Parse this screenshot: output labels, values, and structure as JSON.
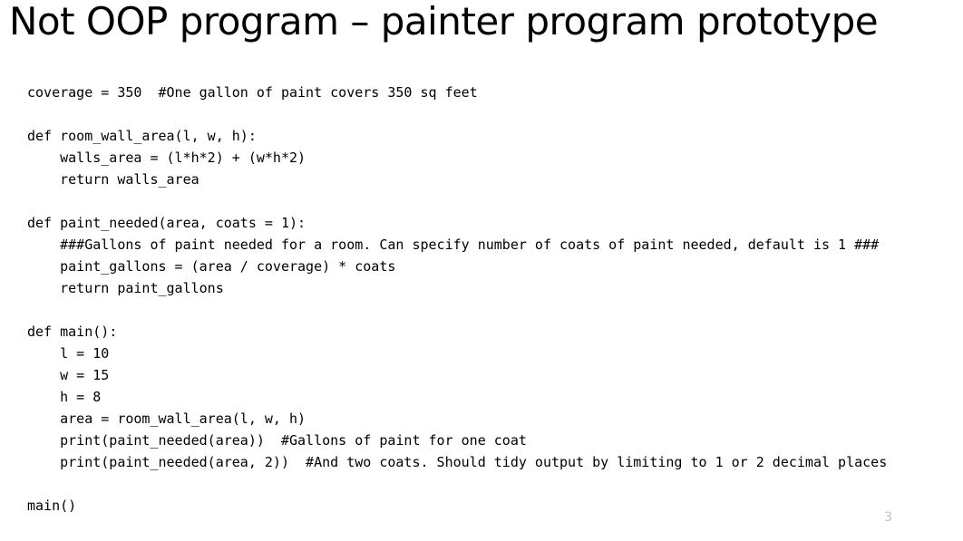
{
  "slide": {
    "title": "Not OOP program – painter program prototype",
    "page_number": "3",
    "code": "coverage = 350  #One gallon of paint covers 350 sq feet\n\ndef room_wall_area(l, w, h):\n    walls_area = (l*h*2) + (w*h*2)\n    return walls_area\n\ndef paint_needed(area, coats = 1):\n    ###Gallons of paint needed for a room. Can specify number of coats of paint needed, default is 1 ###\n    paint_gallons = (area / coverage) * coats\n    return paint_gallons\n\ndef main():\n    l = 10\n    w = 15\n    h = 8\n    area = room_wall_area(l, w, h)\n    print(paint_needed(area))  #Gallons of paint for one coat\n    print(paint_needed(area, 2))  #And two coats. Should tidy output by limiting to 1 or 2 decimal places\n\nmain()"
  }
}
